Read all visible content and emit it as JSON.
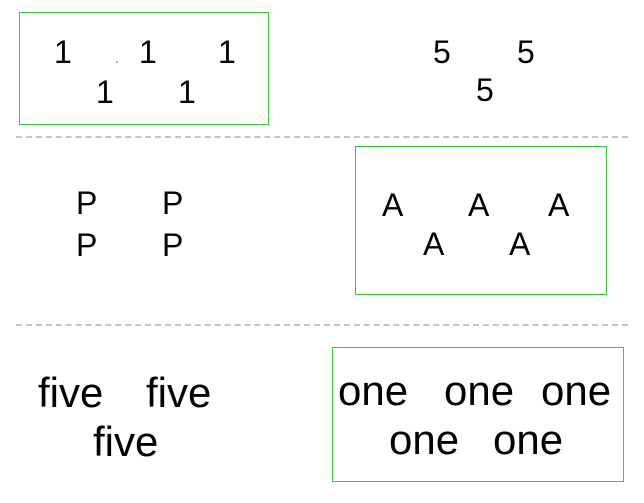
{
  "colors": {
    "box_border": "#33cc33",
    "divider": "#c4c4c4",
    "text": "#000000",
    "background": "#ffffff"
  },
  "rows": [
    {
      "left": {
        "framed": true,
        "item_text": "1",
        "count": 5
      },
      "right": {
        "framed": false,
        "item_text": "5",
        "count": 3
      }
    },
    {
      "left": {
        "framed": false,
        "item_text": "P",
        "count": 4
      },
      "right": {
        "framed": true,
        "item_text": "A",
        "count": 5
      }
    },
    {
      "left": {
        "framed": false,
        "item_text": "five",
        "count": 3
      },
      "right": {
        "framed": true,
        "item_text": "one",
        "count": 5
      }
    }
  ]
}
